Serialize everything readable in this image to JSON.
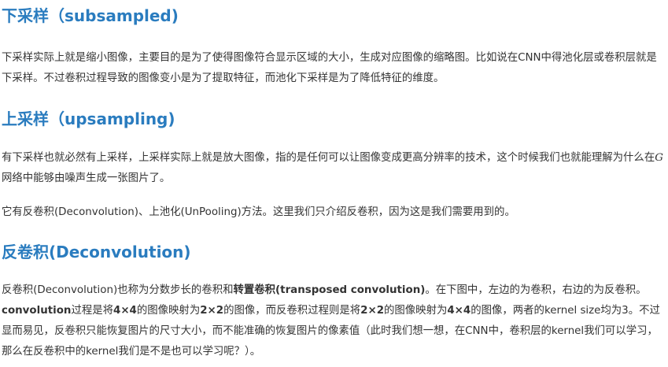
{
  "sections": {
    "downsampling": {
      "heading": "下采样（subsampled)",
      "paragraph": "下采样实际上就是缩小图像，主要目的是为了使得图像符合显示区域的大小，生成对应图像的缩略图。比如说在CNN中得池化层或卷积层就是下采样。不过卷积过程导致的图像变小是为了提取特征，而池化下采样是为了降低特征的维度。"
    },
    "upsampling": {
      "heading": "上采样（upsampling)",
      "p1_before": "有下采样也就必然有上采样，上采样实际上就是放大图像，指的是任何可以让图像变成更高分辨率的技术，这个时候我们也就能理解为什么在",
      "p1_math": "G",
      "p1_after": "网络中能够由噪声生成一张图片了。",
      "p2": "它有反卷积(Deconvolution)、上池化(UnPooling)方法。这里我们只介绍反卷积，因为这是我们需要用到的。"
    },
    "deconvolution": {
      "heading": "反卷积(Deconvolution)",
      "t1": "反卷积(Deconvolution)也称为分数步长的卷积和",
      "b1": "转置卷积(transposed convolution)",
      "t2": "。在下图中，左边的为卷积，右边的为反卷积。",
      "b2": "convolution",
      "t3": "过程是将",
      "b3": "4×4",
      "t4": "的图像映射为",
      "b4": "2×2",
      "t5": "的图像，而反卷积过程则是将",
      "b5": "2×2",
      "t6": "的图像映射为",
      "b6": "4×4",
      "t7": "的图像，两者的kernel size均为3。不过显而易见，反卷积只能恢复图片的尺寸大小，而不能准确的恢复图片的像素值（此时我们想一想，在CNN中，卷积层的kernel我们可以学习，那么在反卷积中的kernel我们是不是也可以学习呢？）。"
    }
  },
  "colors": {
    "heading": "#2a7cbf",
    "text": "#333333",
    "background": "#ffffff"
  }
}
